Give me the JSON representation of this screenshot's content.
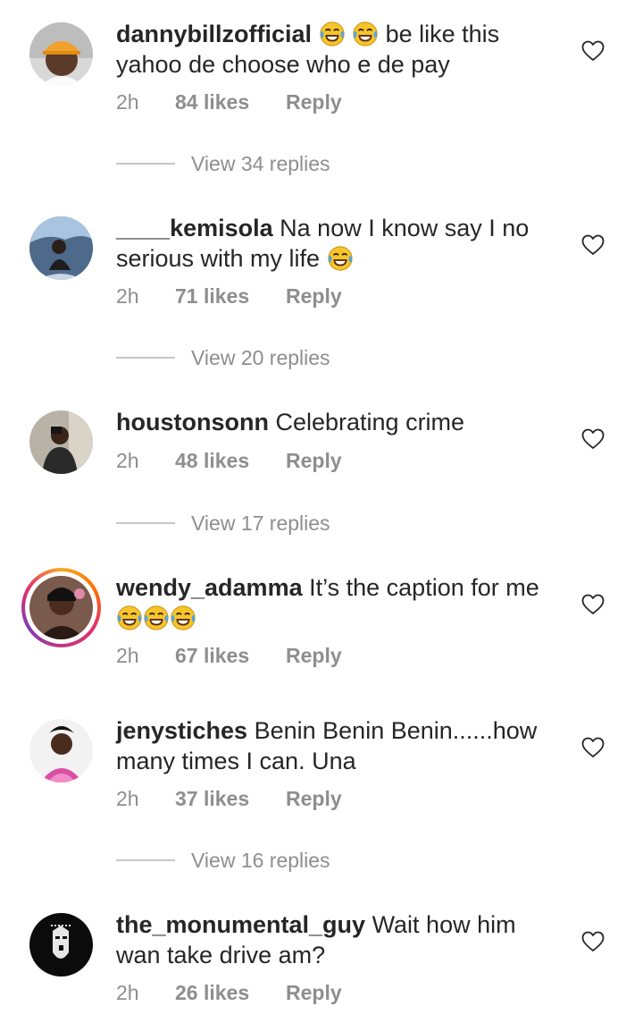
{
  "comments": [
    {
      "username": "dannybillzofficial",
      "text_lines": [
        "be like this",
        "yahoo de choose who e de pay"
      ],
      "time": "2h",
      "likes": "84 likes",
      "reply": "Reply",
      "view_replies": "View 34 replies",
      "avatar_icon": "avatar-cap-photo"
    },
    {
      "username": "____kemisola",
      "text_lines": [
        "Na now I know say I no",
        "serious with my life"
      ],
      "time": "2h",
      "likes": "71 likes",
      "reply": "Reply",
      "view_replies": "View 20 replies",
      "avatar_icon": "avatar-beach-photo"
    },
    {
      "username": "houstonsonn",
      "text_lines": [
        "Celebrating crime"
      ],
      "time": "2h",
      "likes": "48 likes",
      "reply": "Reply",
      "view_replies": "View 17 replies",
      "avatar_icon": "avatar-mirror-selfie"
    },
    {
      "username": "wendy_adamma",
      "text_lines": [
        "It’s the caption for me"
      ],
      "time": "2h",
      "likes": "67 likes",
      "reply": "Reply",
      "avatar_icon": "avatar-story-ring"
    },
    {
      "username": "jenystiches",
      "text_lines": [
        "Benin  Benin Benin......how",
        "many times I can. Una"
      ],
      "time": "2h",
      "likes": "37 likes",
      "reply": "Reply",
      "view_replies": "View 16 replies",
      "avatar_icon": "avatar-woman-photo"
    },
    {
      "username": "the_monumental_guy",
      "text_lines": [
        "Wait how him",
        "wan take drive am?"
      ],
      "time": "2h",
      "likes": "26 likes",
      "reply": "Reply",
      "avatar_icon": "avatar-mask-logo"
    }
  ],
  "colors": {
    "text": "#262626",
    "muted": "#8e8e8e",
    "divider": "#c7c7c7"
  }
}
